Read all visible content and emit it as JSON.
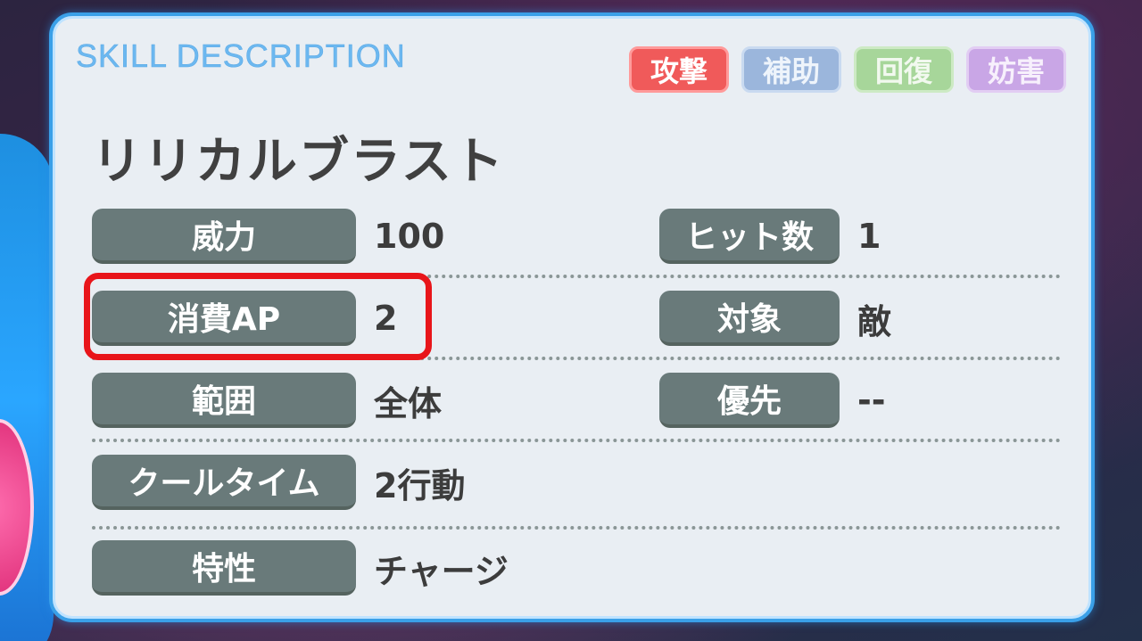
{
  "header": {
    "title": "SKILL DESCRIPTION",
    "tags": [
      "攻撃",
      "補助",
      "回復",
      "妨害"
    ]
  },
  "skill": {
    "name": "リリカルブラスト"
  },
  "stats": {
    "power": {
      "label": "威力",
      "value": "100"
    },
    "hits": {
      "label": "ヒット数",
      "value": "1"
    },
    "ap_cost": {
      "label": "消費AP",
      "value": "2"
    },
    "target": {
      "label": "対象",
      "value": "敵"
    },
    "range": {
      "label": "範囲",
      "value": "全体"
    },
    "priority": {
      "label": "優先",
      "value": "--"
    },
    "cooltime": {
      "label": "クールタイム",
      "value": "2行動"
    },
    "trait": {
      "label": "特性",
      "value": "チャージ"
    }
  },
  "colors": {
    "panel_border": "#3aa0e8",
    "label_bg": "#697a7a",
    "highlight": "#e8151a",
    "tag_attack": "#f05a5a",
    "tag_support": "#9bb6dc",
    "tag_heal": "#a7d69a",
    "tag_debuff": "#c9a6e6"
  }
}
